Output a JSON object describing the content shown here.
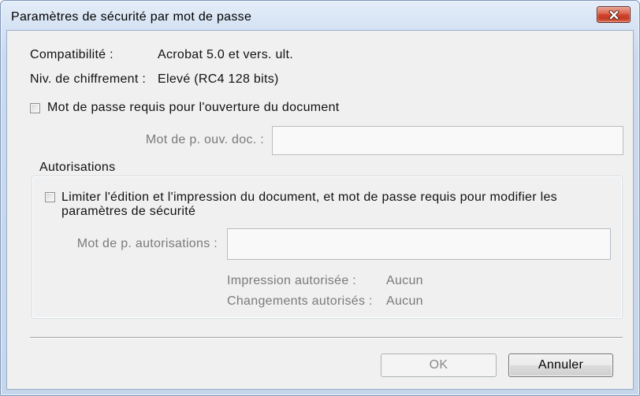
{
  "window": {
    "title": "Paramètres de sécurité par mot de passe",
    "close_icon": "close-icon"
  },
  "info": {
    "compatibility_label": "Compatibilité :",
    "compatibility_value": "Acrobat 5.0 et vers. ult.",
    "encryption_label": "Niv. de chiffrement :",
    "encryption_value": "Elevé (RC4 128 bits)"
  },
  "open_password": {
    "checkbox_label": "Mot de passe requis pour l'ouverture du document",
    "checked": false,
    "field_label": "Mot de p. ouv. doc. :",
    "field_value": "",
    "field_enabled": false
  },
  "permissions": {
    "group_title": "Autorisations",
    "checkbox_label": "Limiter l'édition et l'impression du document, et mot de passe requis pour modifier les paramètres de sécurité",
    "checked": false,
    "field_label": "Mot de p. autorisations :",
    "field_value": "",
    "fields_enabled": false,
    "printing_label": "Impression autorisée :",
    "printing_value": "Aucun",
    "changes_label": "Changements autorisés :",
    "changes_value": "Aucun"
  },
  "buttons": {
    "ok_label": "OK",
    "ok_enabled": false,
    "cancel_label": "Annuler"
  },
  "colors": {
    "dialog_background": "#f0f0f0",
    "disabled_text": "#7a7a7a",
    "close_button": "#cf4530"
  }
}
